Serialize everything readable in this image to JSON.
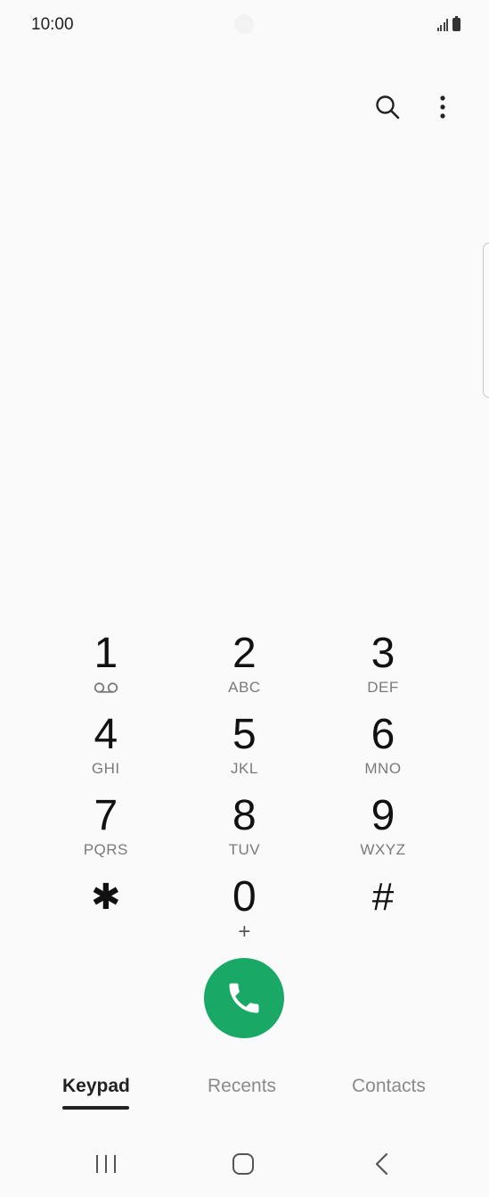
{
  "status_bar": {
    "time": "10:00"
  },
  "actions": {
    "search_icon": "search-icon",
    "more_icon": "more-options-icon"
  },
  "keypad": {
    "rows": [
      [
        {
          "digit": "1",
          "letters": ""
        },
        {
          "digit": "2",
          "letters": "ABC"
        },
        {
          "digit": "3",
          "letters": "DEF"
        }
      ],
      [
        {
          "digit": "4",
          "letters": "GHI"
        },
        {
          "digit": "5",
          "letters": "JKL"
        },
        {
          "digit": "6",
          "letters": "MNO"
        }
      ],
      [
        {
          "digit": "7",
          "letters": "PQRS"
        },
        {
          "digit": "8",
          "letters": "TUV"
        },
        {
          "digit": "9",
          "letters": "WXYZ"
        }
      ],
      [
        {
          "digit": "✱",
          "letters": ""
        },
        {
          "digit": "0",
          "letters": "+"
        },
        {
          "digit": "#",
          "letters": ""
        }
      ]
    ]
  },
  "call_button": {
    "icon": "phone-icon",
    "color": "#1aa867"
  },
  "tabs": [
    {
      "label": "Keypad",
      "active": true
    },
    {
      "label": "Recents",
      "active": false
    },
    {
      "label": "Contacts",
      "active": false
    }
  ],
  "nav": {
    "recents_icon": "recent-apps-icon",
    "home_icon": "home-icon",
    "back_icon": "back-icon"
  }
}
